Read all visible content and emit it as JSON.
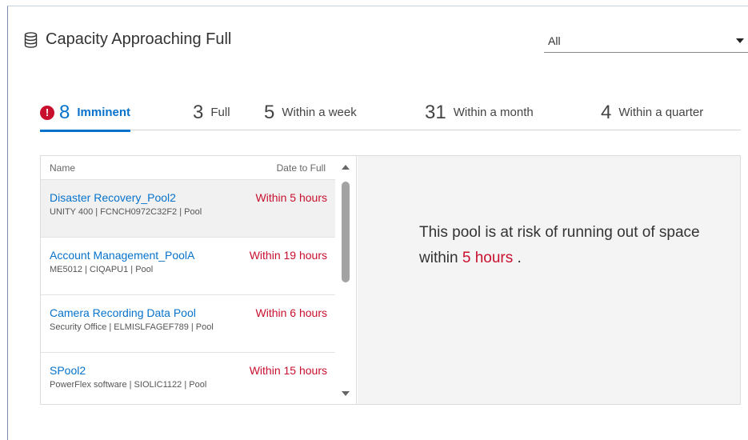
{
  "widget": {
    "title": "Capacity Approaching Full",
    "icon": "database-icon"
  },
  "filter": {
    "selected": "All"
  },
  "tabs": [
    {
      "count": "8",
      "label": "Imminent",
      "active": true,
      "alert": true
    },
    {
      "count": "3",
      "label": "Full"
    },
    {
      "count": "5",
      "label": "Within a week"
    },
    {
      "count": "31",
      "label": "Within a month"
    },
    {
      "count": "4",
      "label": "Within a quarter"
    }
  ],
  "list": {
    "columns": {
      "name": "Name",
      "date": "Date to Full"
    },
    "rows": [
      {
        "name": "Disaster Recovery_Pool2",
        "date": "Within 5 hours",
        "meta": "UNITY 400 | FCNCH0972C32F2 | Pool"
      },
      {
        "name": "Account Management_PoolA",
        "date": "Within 19 hours",
        "meta": "ME5012 | CIQAPU1 | Pool"
      },
      {
        "name": "Camera Recording Data Pool",
        "date": "Within 6 hours",
        "meta": "Security Office | ELMISLFAGEF789 | Pool"
      },
      {
        "name": "SPool2",
        "date": "Within 15 hours",
        "meta": "PowerFlex software | SIOLIC1122 | Pool"
      }
    ]
  },
  "detail": {
    "text_before": "This pool is at risk of running out of space within ",
    "highlight": "5 hours",
    "text_after": " ."
  },
  "colors": {
    "accent": "#0672cb",
    "danger": "#c8102e"
  }
}
